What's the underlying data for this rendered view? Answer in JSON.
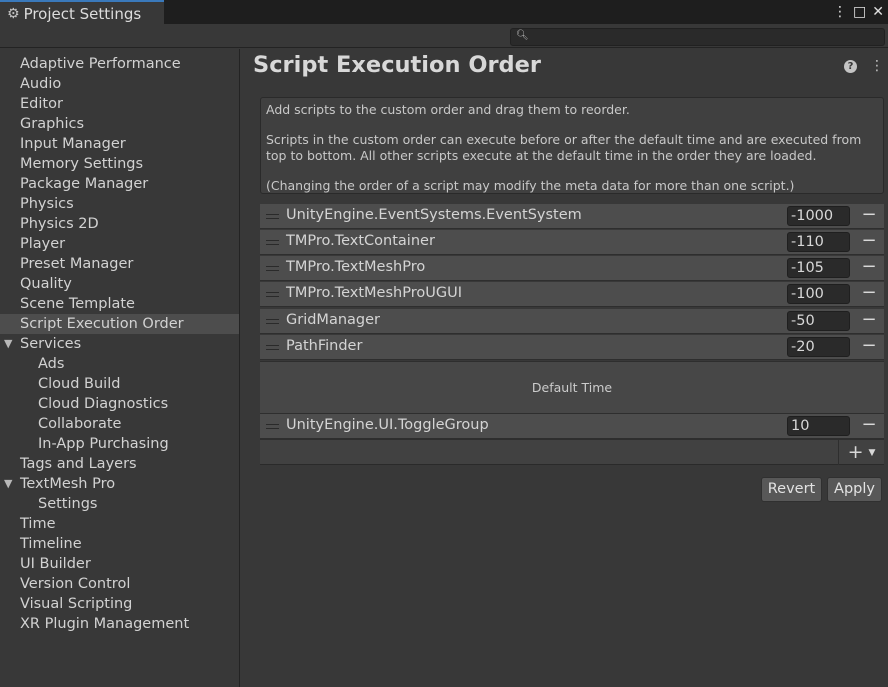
{
  "window": {
    "tab_title": "Project Settings",
    "tab_icon": "gear-icon",
    "menu_icon": "⋮",
    "maximize_icon": "□",
    "close_icon": "✕"
  },
  "search": {
    "placeholder": "",
    "value": ""
  },
  "sidebar": {
    "selected": "Script Execution Order",
    "items": [
      {
        "label": "Adaptive Performance"
      },
      {
        "label": "Audio"
      },
      {
        "label": "Editor"
      },
      {
        "label": "Graphics"
      },
      {
        "label": "Input Manager"
      },
      {
        "label": "Memory Settings"
      },
      {
        "label": "Package Manager"
      },
      {
        "label": "Physics"
      },
      {
        "label": "Physics 2D"
      },
      {
        "label": "Player"
      },
      {
        "label": "Preset Manager"
      },
      {
        "label": "Quality"
      },
      {
        "label": "Scene Template"
      },
      {
        "label": "Script Execution Order"
      },
      {
        "label": "Services",
        "expanded": true
      },
      {
        "label": "Ads"
      },
      {
        "label": "Cloud Build"
      },
      {
        "label": "Cloud Diagnostics"
      },
      {
        "label": "Collaborate"
      },
      {
        "label": "In-App Purchasing"
      },
      {
        "label": "Tags and Layers"
      },
      {
        "label": "TextMesh Pro",
        "expanded": true
      },
      {
        "label": "Settings"
      },
      {
        "label": "Time"
      },
      {
        "label": "Timeline"
      },
      {
        "label": "UI Builder"
      },
      {
        "label": "Version Control"
      },
      {
        "label": "Visual Scripting"
      },
      {
        "label": "XR Plugin Management"
      }
    ]
  },
  "main": {
    "title": "Script Execution Order",
    "help_icon": "?",
    "more_icon": "⋮",
    "info": {
      "line1": "Add scripts to the custom order and drag them to reorder.",
      "line2": "Scripts in the custom order can execute before or after the default time and are executed from top to bottom. All other scripts execute at the default time in the order they are loaded.",
      "line3": "(Changing the order of a script may modify the meta data for more than one script.)"
    },
    "scripts_before": [
      {
        "name": "UnityEngine.EventSystems.EventSystem",
        "order": "-1000"
      },
      {
        "name": "TMPro.TextContainer",
        "order": "-110"
      },
      {
        "name": "TMPro.TextMeshPro",
        "order": "-105"
      },
      {
        "name": "TMPro.TextMeshProUGUI",
        "order": "-100"
      },
      {
        "name": "GridManager",
        "order": "-50"
      },
      {
        "name": "PathFinder",
        "order": "-20"
      }
    ],
    "default_time_label": "Default Time",
    "scripts_after": [
      {
        "name": "UnityEngine.UI.ToggleGroup",
        "order": "10"
      }
    ],
    "remove_glyph": "−",
    "add_glyph": "+",
    "dropdown_glyph": "▼",
    "revert_label": "Revert",
    "apply_label": "Apply"
  }
}
